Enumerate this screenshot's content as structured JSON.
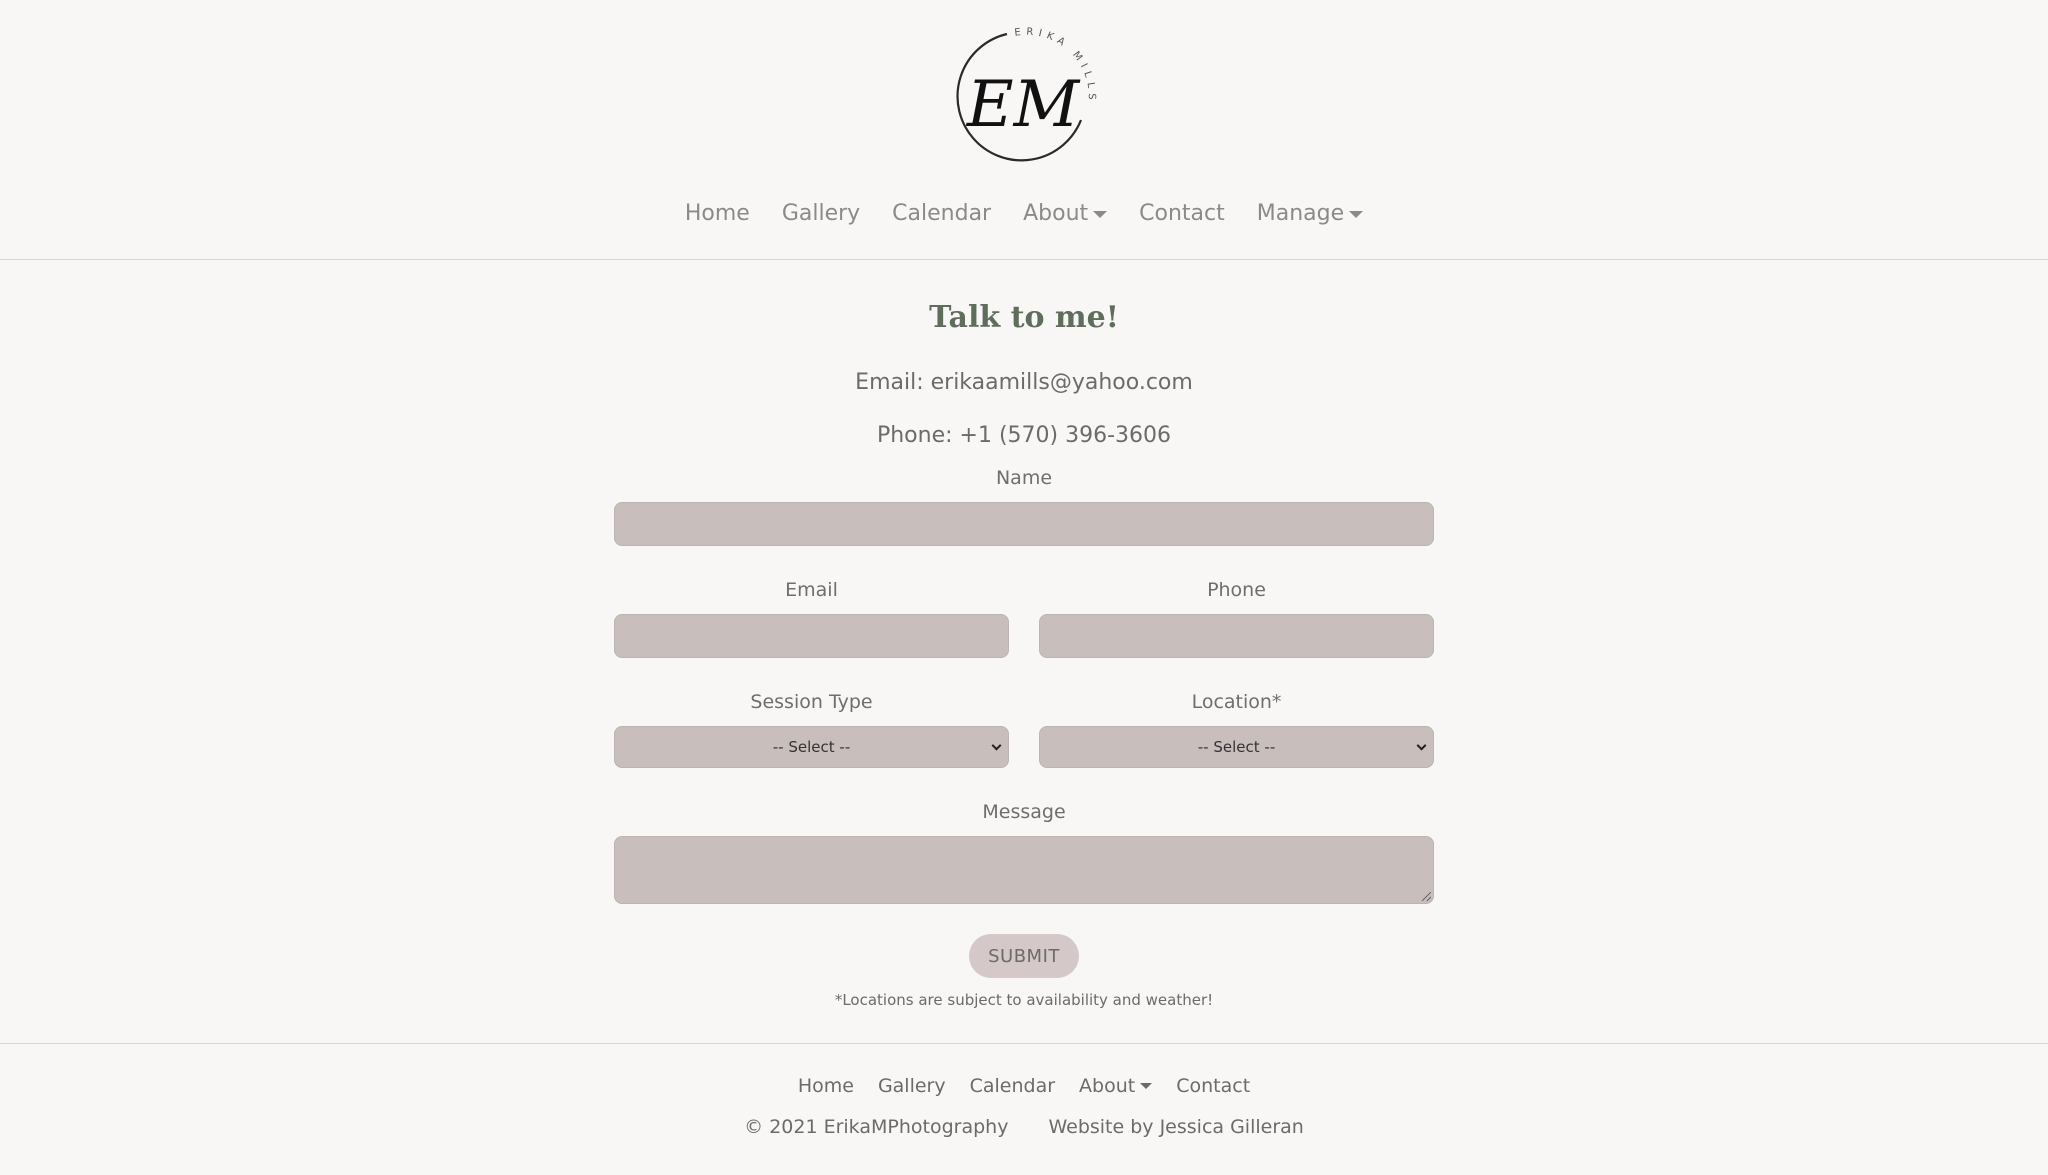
{
  "brand": {
    "logo_monogram": "EM",
    "logo_arc_text": "ERIKA MILLS"
  },
  "nav": {
    "items": [
      {
        "label": "Home",
        "dropdown": false
      },
      {
        "label": "Gallery",
        "dropdown": false
      },
      {
        "label": "Calendar",
        "dropdown": false
      },
      {
        "label": "About",
        "dropdown": true
      },
      {
        "label": "Contact",
        "dropdown": false
      },
      {
        "label": "Manage",
        "dropdown": true
      }
    ]
  },
  "contact": {
    "title": "Talk to me!",
    "email_line": "Email: erikaamills@yahoo.com",
    "phone_line": "Phone: +1 (570) 396-3606"
  },
  "form": {
    "name_label": "Name",
    "email_label": "Email",
    "phone_label": "Phone",
    "session_type_label": "Session Type",
    "session_type_value": "-- Select --",
    "location_label": "Location*",
    "location_value": "-- Select --",
    "message_label": "Message",
    "submit_label": "SUBMIT",
    "disclaimer": "*Locations are subject to availability and weather!"
  },
  "footer": {
    "items": [
      {
        "label": "Home",
        "dropdown": false
      },
      {
        "label": "Gallery",
        "dropdown": false
      },
      {
        "label": "Calendar",
        "dropdown": false
      },
      {
        "label": "About",
        "dropdown": true
      },
      {
        "label": "Contact",
        "dropdown": false
      }
    ],
    "copyright": "© 2021 ErikaMPhotography",
    "credit": "Website by Jessica Gilleran"
  },
  "colors": {
    "background": "#f8f7f6",
    "field_fill": "#c8bebc",
    "button_fill": "#d4c8c8",
    "title_green": "#5e6e5a",
    "nav_text": "#8a8a8a"
  }
}
